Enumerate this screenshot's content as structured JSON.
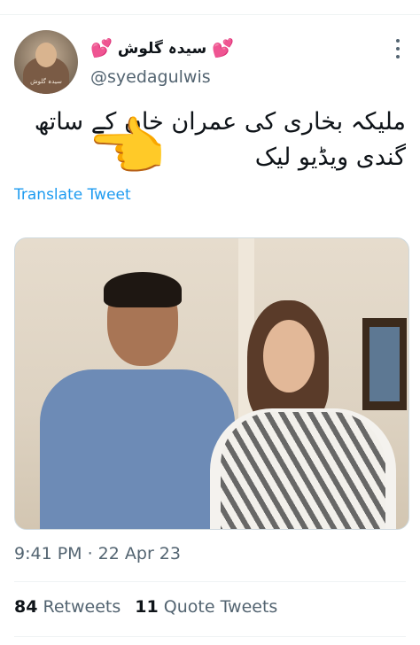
{
  "author": {
    "display_name": "سیدہ گلوش",
    "name_decoration": "💕",
    "handle": "@syedagulwis",
    "avatar_caption": "سیدہ گلوش"
  },
  "icons": {
    "more": "more-options-icon",
    "hand": "backhand-index-pointing-left-emoji"
  },
  "tweet": {
    "line1": "ملیکہ بخاری کی عمران خان کے ساتھ",
    "line2": "گندی ویڈیو لیک",
    "emoji": "👈",
    "translate_label": "Translate Tweet"
  },
  "meta": {
    "timestamp": "9:41 PM · 22 Apr 23"
  },
  "stats": {
    "retweets_count": "84",
    "retweets_label": "Retweets",
    "quotes_count": "11",
    "quotes_label": "Quote Tweets"
  },
  "colors": {
    "link": "#1d9bf0",
    "secondary_text": "#536471",
    "primary_text": "#0f1419"
  }
}
